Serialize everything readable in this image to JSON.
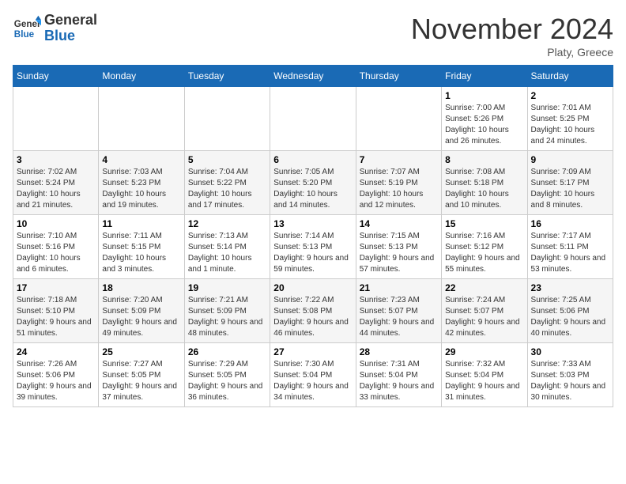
{
  "header": {
    "logo_general": "General",
    "logo_blue": "Blue",
    "month_title": "November 2024",
    "location": "Platy, Greece"
  },
  "weekdays": [
    "Sunday",
    "Monday",
    "Tuesday",
    "Wednesday",
    "Thursday",
    "Friday",
    "Saturday"
  ],
  "weeks": [
    [
      {
        "day": "",
        "info": ""
      },
      {
        "day": "",
        "info": ""
      },
      {
        "day": "",
        "info": ""
      },
      {
        "day": "",
        "info": ""
      },
      {
        "day": "",
        "info": ""
      },
      {
        "day": "1",
        "info": "Sunrise: 7:00 AM\nSunset: 5:26 PM\nDaylight: 10 hours and 26 minutes."
      },
      {
        "day": "2",
        "info": "Sunrise: 7:01 AM\nSunset: 5:25 PM\nDaylight: 10 hours and 24 minutes."
      }
    ],
    [
      {
        "day": "3",
        "info": "Sunrise: 7:02 AM\nSunset: 5:24 PM\nDaylight: 10 hours and 21 minutes."
      },
      {
        "day": "4",
        "info": "Sunrise: 7:03 AM\nSunset: 5:23 PM\nDaylight: 10 hours and 19 minutes."
      },
      {
        "day": "5",
        "info": "Sunrise: 7:04 AM\nSunset: 5:22 PM\nDaylight: 10 hours and 17 minutes."
      },
      {
        "day": "6",
        "info": "Sunrise: 7:05 AM\nSunset: 5:20 PM\nDaylight: 10 hours and 14 minutes."
      },
      {
        "day": "7",
        "info": "Sunrise: 7:07 AM\nSunset: 5:19 PM\nDaylight: 10 hours and 12 minutes."
      },
      {
        "day": "8",
        "info": "Sunrise: 7:08 AM\nSunset: 5:18 PM\nDaylight: 10 hours and 10 minutes."
      },
      {
        "day": "9",
        "info": "Sunrise: 7:09 AM\nSunset: 5:17 PM\nDaylight: 10 hours and 8 minutes."
      }
    ],
    [
      {
        "day": "10",
        "info": "Sunrise: 7:10 AM\nSunset: 5:16 PM\nDaylight: 10 hours and 6 minutes."
      },
      {
        "day": "11",
        "info": "Sunrise: 7:11 AM\nSunset: 5:15 PM\nDaylight: 10 hours and 3 minutes."
      },
      {
        "day": "12",
        "info": "Sunrise: 7:13 AM\nSunset: 5:14 PM\nDaylight: 10 hours and 1 minute."
      },
      {
        "day": "13",
        "info": "Sunrise: 7:14 AM\nSunset: 5:13 PM\nDaylight: 9 hours and 59 minutes."
      },
      {
        "day": "14",
        "info": "Sunrise: 7:15 AM\nSunset: 5:13 PM\nDaylight: 9 hours and 57 minutes."
      },
      {
        "day": "15",
        "info": "Sunrise: 7:16 AM\nSunset: 5:12 PM\nDaylight: 9 hours and 55 minutes."
      },
      {
        "day": "16",
        "info": "Sunrise: 7:17 AM\nSunset: 5:11 PM\nDaylight: 9 hours and 53 minutes."
      }
    ],
    [
      {
        "day": "17",
        "info": "Sunrise: 7:18 AM\nSunset: 5:10 PM\nDaylight: 9 hours and 51 minutes."
      },
      {
        "day": "18",
        "info": "Sunrise: 7:20 AM\nSunset: 5:09 PM\nDaylight: 9 hours and 49 minutes."
      },
      {
        "day": "19",
        "info": "Sunrise: 7:21 AM\nSunset: 5:09 PM\nDaylight: 9 hours and 48 minutes."
      },
      {
        "day": "20",
        "info": "Sunrise: 7:22 AM\nSunset: 5:08 PM\nDaylight: 9 hours and 46 minutes."
      },
      {
        "day": "21",
        "info": "Sunrise: 7:23 AM\nSunset: 5:07 PM\nDaylight: 9 hours and 44 minutes."
      },
      {
        "day": "22",
        "info": "Sunrise: 7:24 AM\nSunset: 5:07 PM\nDaylight: 9 hours and 42 minutes."
      },
      {
        "day": "23",
        "info": "Sunrise: 7:25 AM\nSunset: 5:06 PM\nDaylight: 9 hours and 40 minutes."
      }
    ],
    [
      {
        "day": "24",
        "info": "Sunrise: 7:26 AM\nSunset: 5:06 PM\nDaylight: 9 hours and 39 minutes."
      },
      {
        "day": "25",
        "info": "Sunrise: 7:27 AM\nSunset: 5:05 PM\nDaylight: 9 hours and 37 minutes."
      },
      {
        "day": "26",
        "info": "Sunrise: 7:29 AM\nSunset: 5:05 PM\nDaylight: 9 hours and 36 minutes."
      },
      {
        "day": "27",
        "info": "Sunrise: 7:30 AM\nSunset: 5:04 PM\nDaylight: 9 hours and 34 minutes."
      },
      {
        "day": "28",
        "info": "Sunrise: 7:31 AM\nSunset: 5:04 PM\nDaylight: 9 hours and 33 minutes."
      },
      {
        "day": "29",
        "info": "Sunrise: 7:32 AM\nSunset: 5:04 PM\nDaylight: 9 hours and 31 minutes."
      },
      {
        "day": "30",
        "info": "Sunrise: 7:33 AM\nSunset: 5:03 PM\nDaylight: 9 hours and 30 minutes."
      }
    ]
  ]
}
